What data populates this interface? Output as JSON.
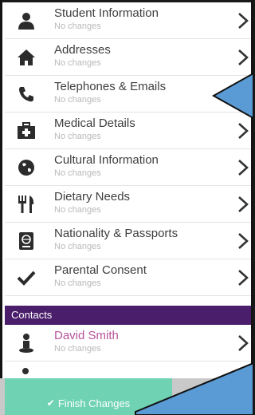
{
  "sections": [
    {
      "label": "Student Information",
      "sub": "No changes",
      "icon": "person-icon"
    },
    {
      "label": "Addresses",
      "sub": "No changes",
      "icon": "home-icon"
    },
    {
      "label": "Telephones & Emails",
      "sub": "No changes",
      "icon": "phone-icon"
    },
    {
      "label": "Medical Details",
      "sub": "No changes",
      "icon": "medical-kit-icon"
    },
    {
      "label": "Cultural Information",
      "sub": "No changes",
      "icon": "globe-icon"
    },
    {
      "label": "Dietary Needs",
      "sub": "No changes",
      "icon": "cutlery-icon"
    },
    {
      "label": "Nationality & Passports",
      "sub": "No changes",
      "icon": "passport-icon"
    },
    {
      "label": "Parental Consent",
      "sub": "No changes",
      "icon": "checkmark-icon"
    }
  ],
  "contacts": {
    "header": "Contacts",
    "items": [
      {
        "label": "David Smith",
        "sub": "No changes",
        "icon": "contact-person-icon"
      }
    ]
  },
  "footer": {
    "finish_label": "Finish Changes",
    "finish_icon": "checkmark-icon"
  },
  "colors": {
    "accent_purple": "#4a1e6b",
    "finish_green": "#6fd2b3",
    "contact_name": "#b8539b",
    "callout_blue": "#5b9bd5"
  }
}
